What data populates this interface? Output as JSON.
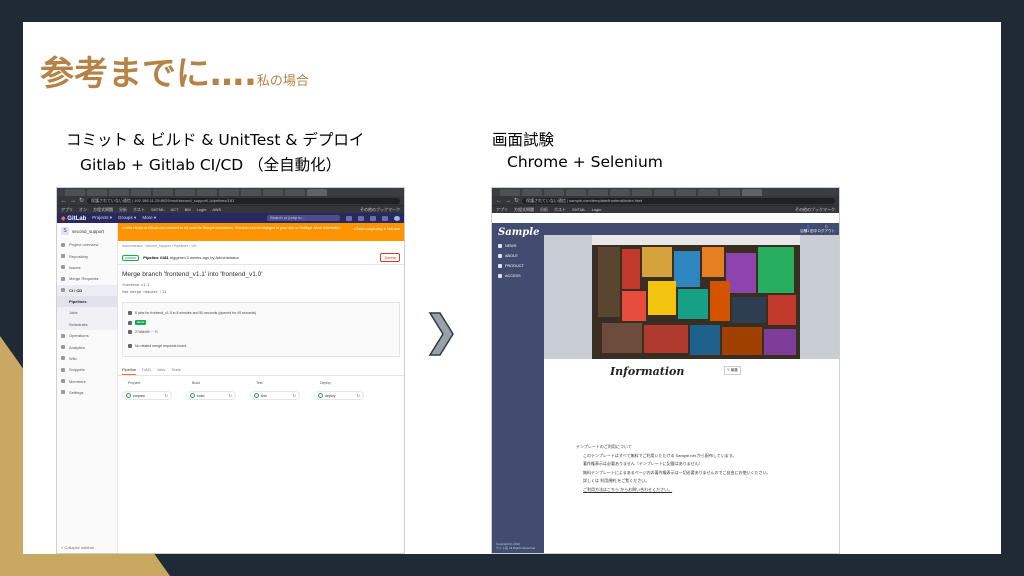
{
  "slide": {
    "title_main": "参考までに….",
    "title_sub": "私の場合"
  },
  "left": {
    "caption_line1": "コミット & ビルド & UnitTest & デプロイ",
    "caption_line2": "Gitlab + Gitlab CI/CD （全自動化）"
  },
  "right": {
    "caption_line1": "画面試験",
    "caption_line2": "Chrome + Selenium"
  },
  "gitlab_window": {
    "url": "保護されていない通信 | 192.168.11.25:8929/root/second_support/-/pipelines/181",
    "bookmarks": [
      "アプリ",
      "オン",
      "方程式問題",
      "分析",
      "ホスト",
      "SHTML",
      "ACT",
      "BM",
      "Login",
      "AWS",
      "その他のブックマーク"
    ],
    "header": {
      "logo": "GitLab",
      "nav": [
        "Projects ▾",
        "Groups ▾",
        "More ▾"
      ],
      "search_placeholder": "Search or jump to..."
    },
    "sidebar": {
      "project_initial": "S",
      "project_name": "second_support",
      "items": [
        "Project overview",
        "Repository",
        "Issues",
        "Merge Requests"
      ],
      "cicd_label": "CI / CD",
      "cicd_subitems": [
        "Pipelines",
        "Jobs",
        "Schedules"
      ],
      "items_after": [
        "Operations",
        "Analytics",
        "Wiki",
        "Snippets",
        "Members",
        "Settings"
      ],
      "collapse_label": "« Collapse sidebar"
    },
    "banner_text": "A Web Hooks at GitLab.com seemed to be used for Sample Information. This item can be changed at your user or Settings. More information.",
    "banner_right": "Check usage ping ✕ Not now",
    "breadcrumb": "Administrator › second_support › Pipelines › 181",
    "pipeline_status": "passed",
    "pipeline_id": "Pipeline #181",
    "pipeline_meta": "triggered 2 weeks ago by",
    "pipeline_author": "Administrator",
    "delete_label": "Delete",
    "commit_title": "Merge branch 'frontend_v1.1' into 'frontend_v1.0'",
    "commit_body": [
      "frontend v1.1",
      "See merge request !11"
    ],
    "info_rows": [
      "6 jobs for frontend_v1.0 in 8 minutes and 50 seconds (queued for 49 seconds)",
      "latest",
      "27d6b4f9 ··· ⎘",
      "No related merge requests found."
    ],
    "tabs": [
      "Pipeline",
      "DAG",
      "Jobs",
      "Tests"
    ],
    "stages": [
      {
        "name": "Prepare",
        "job": "prepare"
      },
      {
        "name": "Build",
        "job": "build"
      },
      {
        "name": "Test",
        "job": "test"
      },
      {
        "name": "Deploy",
        "job": "deploy"
      }
    ]
  },
  "sample_window": {
    "url": "保護されていない通信 | sample.com/template/frontend/index.html",
    "bookmarks": [
      "アプリ",
      "方程式問題",
      "分析",
      "ホスト",
      "SHTML",
      "Login",
      "その他のブックマーク"
    ],
    "logo": "Sample",
    "nav": [
      "NEWS",
      "ABOUT",
      "PRODUCT",
      "ACCESS"
    ],
    "user_label": "店舗1 田中",
    "logout_label": "ログアウト",
    "info_title": "Information",
    "edit_label": "編集",
    "text_heading": "テンプレートのご利用について",
    "text_lines": [
      "このテンプレートはすべて無料でご利用いただける Sample.net から配布しています。",
      "著作権表示は必要ありません（テンプレートに記載はありません）",
      "無料テンプレートによるあるページ内の著作権表示は一切必要ありませんのでご自由にお使いください。",
      "詳しくは 利用規約 をご覧ください。",
      "ご利用方法はこちら からお問い合わせください。"
    ],
    "copyright": "Copyright(c) 2019\nサイト名 All Rights Reserved"
  },
  "colors": {
    "title": "#b48345",
    "slide_bg": "#ffffff",
    "page_bg": "#1f2a36",
    "accent_wedge": "#c9a862",
    "gitlab_header": "#292961",
    "banner": "#fc9403",
    "sample_sidebar": "#414c70"
  }
}
